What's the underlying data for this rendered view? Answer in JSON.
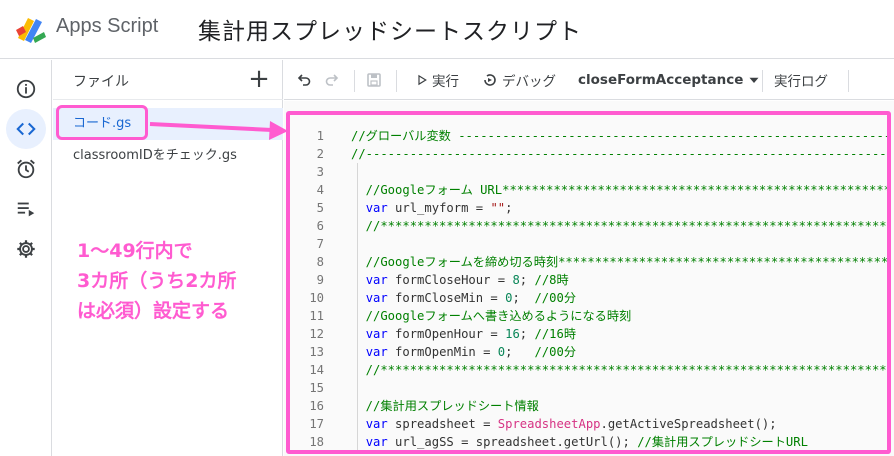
{
  "header": {
    "app_name": "Apps Script",
    "project_title": "集計用スプレッドシートスクリプト"
  },
  "rail": {
    "items": [
      "info-icon",
      "code-icon",
      "alarm-icon",
      "executions-icon",
      "settings-icon"
    ],
    "active": "code-icon"
  },
  "files": {
    "title": "ファイル",
    "add_label": "+",
    "items": [
      {
        "name": "コード.gs"
      },
      {
        "name": "classroomIDをチェック.gs"
      }
    ]
  },
  "annotation": {
    "lines": [
      "1〜49行内で",
      "3カ所（うち2カ所",
      "は必須）設定する"
    ]
  },
  "toolbar": {
    "run_label": "実行",
    "debug_label": "デバッグ",
    "function_selected": "closeFormAcceptance",
    "log_label": "実行ログ"
  },
  "colors": {
    "annotation_accent": "#ff5bd0",
    "active_file_bg": "#e8f0fe"
  },
  "code": {
    "lines": [
      {
        "n": "1",
        "parts": [
          {
            "t": "//グローバル変数 ---------------------------------------------------------------",
            "c": "cm"
          }
        ]
      },
      {
        "n": "2",
        "parts": [
          {
            "t": "//-----------------------------------------------------------------------------",
            "c": "cm"
          }
        ]
      },
      {
        "n": "3",
        "parts": []
      },
      {
        "n": "4",
        "parts": [
          {
            "t": "  //Googleフォーム URL*********************************************************",
            "c": "cm"
          }
        ]
      },
      {
        "n": "5",
        "parts": [
          {
            "t": "  ",
            "c": ""
          },
          {
            "t": "var",
            "c": "kw"
          },
          {
            "t": " url_myform = ",
            "c": ""
          },
          {
            "t": "\"\"",
            "c": "str"
          },
          {
            "t": ";",
            "c": ""
          }
        ]
      },
      {
        "n": "6",
        "parts": [
          {
            "t": "  //****************************************************************************",
            "c": "cm"
          }
        ]
      },
      {
        "n": "7",
        "parts": []
      },
      {
        "n": "8",
        "parts": [
          {
            "t": "  //Googleフォームを締め切る時刻**********************************************",
            "c": "cm"
          }
        ]
      },
      {
        "n": "9",
        "parts": [
          {
            "t": "  ",
            "c": ""
          },
          {
            "t": "var",
            "c": "kw"
          },
          {
            "t": " formCloseHour = ",
            "c": ""
          },
          {
            "t": "8",
            "c": "num"
          },
          {
            "t": "; ",
            "c": ""
          },
          {
            "t": "//8時",
            "c": "cm"
          }
        ]
      },
      {
        "n": "10",
        "parts": [
          {
            "t": "  ",
            "c": ""
          },
          {
            "t": "var",
            "c": "kw"
          },
          {
            "t": " formCloseMin = ",
            "c": ""
          },
          {
            "t": "0",
            "c": "num"
          },
          {
            "t": ";  ",
            "c": ""
          },
          {
            "t": "//00分",
            "c": "cm"
          }
        ]
      },
      {
        "n": "11",
        "parts": [
          {
            "t": "  //Googleフォームへ書き込めるようになる時刻",
            "c": "cm"
          }
        ]
      },
      {
        "n": "12",
        "parts": [
          {
            "t": "  ",
            "c": ""
          },
          {
            "t": "var",
            "c": "kw"
          },
          {
            "t": " formOpenHour = ",
            "c": ""
          },
          {
            "t": "16",
            "c": "num"
          },
          {
            "t": "; ",
            "c": ""
          },
          {
            "t": "//16時",
            "c": "cm"
          }
        ]
      },
      {
        "n": "13",
        "parts": [
          {
            "t": "  ",
            "c": ""
          },
          {
            "t": "var",
            "c": "kw"
          },
          {
            "t": " formOpenMin = ",
            "c": ""
          },
          {
            "t": "0",
            "c": "num"
          },
          {
            "t": ";   ",
            "c": ""
          },
          {
            "t": "//00分",
            "c": "cm"
          }
        ]
      },
      {
        "n": "14",
        "parts": [
          {
            "t": "  //****************************************************************************",
            "c": "cm"
          }
        ]
      },
      {
        "n": "15",
        "parts": []
      },
      {
        "n": "16",
        "parts": [
          {
            "t": "  //集計用スプレッドシート情報",
            "c": "cm"
          }
        ]
      },
      {
        "n": "17",
        "parts": [
          {
            "t": "  ",
            "c": ""
          },
          {
            "t": "var",
            "c": "kw"
          },
          {
            "t": " spreadsheet = ",
            "c": ""
          },
          {
            "t": "SpreadsheetApp",
            "c": "cls"
          },
          {
            "t": ".getActiveSpreadsheet();",
            "c": ""
          }
        ]
      },
      {
        "n": "18",
        "parts": [
          {
            "t": "  ",
            "c": ""
          },
          {
            "t": "var",
            "c": "kw"
          },
          {
            "t": " url_agSS = spreadsheet.getUrl(); ",
            "c": ""
          },
          {
            "t": "//集計用スプレッドシートURL",
            "c": "cm"
          }
        ]
      }
    ]
  }
}
